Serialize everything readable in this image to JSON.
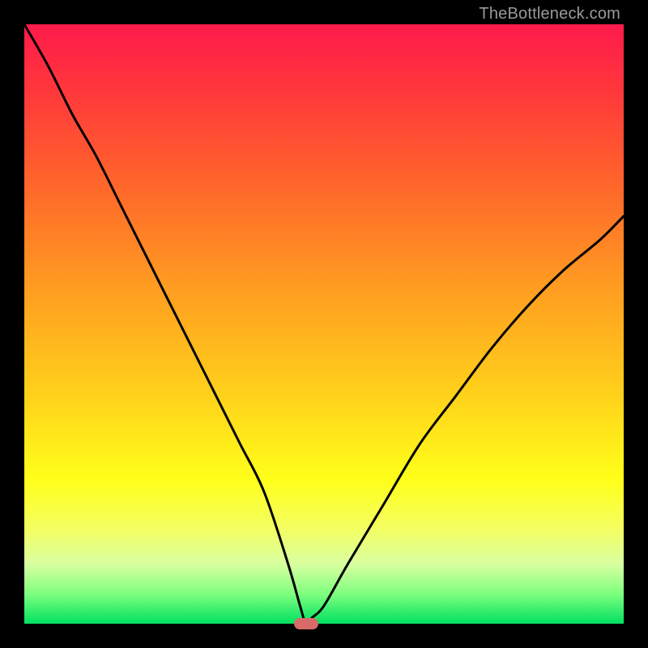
{
  "watermark": "TheBottleneck.com",
  "colors": {
    "grad_top": "#ff1a4b",
    "grad_bottom": "#00e060",
    "curve": "#000000",
    "marker": "#d86a6a",
    "frame": "#000000"
  },
  "chart_data": {
    "type": "line",
    "title": "",
    "xlabel": "",
    "ylabel": "",
    "xlim": [
      0,
      100
    ],
    "ylim": [
      0,
      100
    ],
    "annotations": [
      "TheBottleneck.com"
    ],
    "note": "V-shaped bottleneck curve; minimum near x≈47. Values estimated from pixel positions.",
    "series": [
      {
        "name": "bottleneck-curve",
        "x": [
          0,
          4,
          8,
          12,
          16,
          20,
          24,
          28,
          32,
          36,
          40,
          44,
          46,
          47,
          48,
          50,
          54,
          60,
          66,
          72,
          78,
          84,
          90,
          96,
          100
        ],
        "y": [
          100,
          93,
          85,
          78,
          70,
          62,
          54,
          46,
          38,
          30,
          22,
          10,
          3,
          0,
          1,
          3,
          10,
          20,
          30,
          38,
          46,
          53,
          59,
          64,
          68
        ]
      }
    ],
    "marker": {
      "x": 47,
      "y": 0,
      "shape": "pill",
      "color": "#d86a6a"
    }
  }
}
